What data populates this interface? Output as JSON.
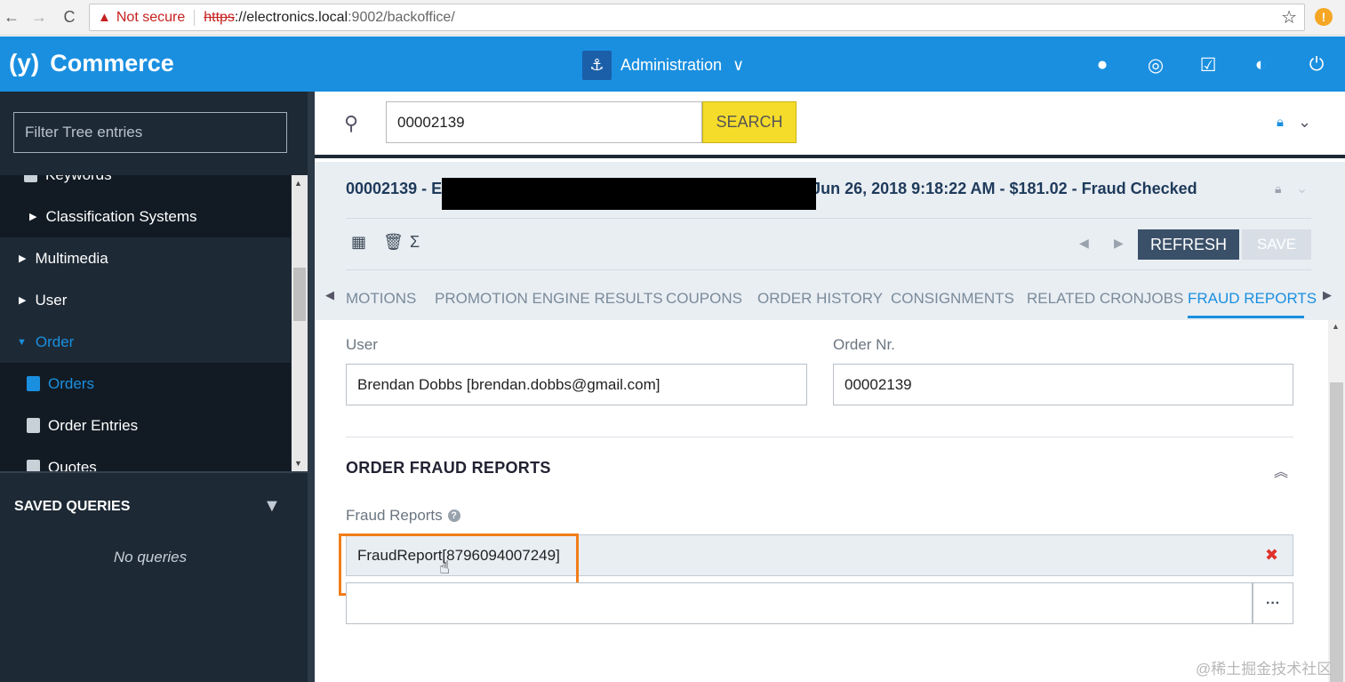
{
  "browser": {
    "back": "←",
    "forward": "→",
    "reload": "C",
    "security_label": "Not secure",
    "url_protocol": "https",
    "url_host": "://electronics.local",
    "url_path": ":9002/backoffice/",
    "bookmark": "☆",
    "extension": "!"
  },
  "header": {
    "logo_mark": "(y)",
    "logo_text": "Commerce",
    "perspective": "Administration",
    "perspective_chevron": "∨",
    "icons": [
      "user-icon",
      "sync-icon",
      "checklist-icon",
      "globe-icon",
      "power-icon"
    ]
  },
  "sidebar": {
    "filter_placeholder": "Filter Tree entries",
    "tree": [
      {
        "label": "Keywords",
        "type": "sub",
        "icon": "doc-icon"
      },
      {
        "label": "Classification Systems",
        "type": "sub-arrow"
      },
      {
        "label": "Multimedia",
        "type": "arrow"
      },
      {
        "label": "User",
        "type": "arrow"
      },
      {
        "label": "Order",
        "type": "open"
      },
      {
        "label": "Orders",
        "type": "active-icon"
      },
      {
        "label": "Order Entries",
        "type": "icon"
      },
      {
        "label": "Quotes",
        "type": "icon"
      }
    ],
    "saved_queries_title": "SAVED QUERIES",
    "no_queries": "No queries"
  },
  "search": {
    "value": "00002139",
    "button": "SEARCH"
  },
  "editor": {
    "title_prefix": "00002139 - E",
    "title_suffix": "Jun 26, 2018 9:18:22 AM - $181.02 - Fraud Checked",
    "refresh": "REFRESH",
    "save": "SAVE",
    "tabs": [
      "MOTIONS",
      "PROMOTION ENGINE RESULTS",
      "COUPONS",
      "ORDER HISTORY",
      "CONSIGNMENTS",
      "RELATED CRONJOBS",
      "FRAUD REPORTS"
    ],
    "active_tab": "FRAUD REPORTS"
  },
  "content": {
    "user_label": "User",
    "user_value": "Brendan Dobbs [brendan.dobbs@gmail.com]",
    "order_nr_label": "Order Nr.",
    "order_nr_value": "00002139",
    "section_title": "ORDER FRAUD REPORTS",
    "fraud_reports_label": "Fraud Reports",
    "fraud_report_item": "FraudReport[8796094007249]",
    "more_button": "···",
    "remove": "✖"
  },
  "watermark": "@稀土掘金技术社区",
  "colors": {
    "header": "#1a8fe0",
    "sidebar": "#1d2935",
    "search_button": "#f6dc2a",
    "highlight": "#f07d1a",
    "refresh": "#3a5068"
  }
}
